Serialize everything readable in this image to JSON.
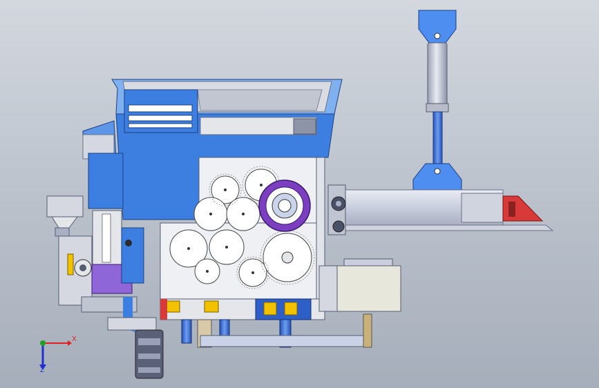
{
  "viewport": {
    "background_top": "#d3d8df",
    "background_bottom": "#a6aebb"
  },
  "colors": {
    "body_blue": "#3c7fe0",
    "body_blue_light": "#7fb0f0",
    "panel_grey": "#e4e6ea",
    "gear_purple": "#7b3fc0",
    "hopper_blue": "#4d8ef0",
    "cylinder_grey": "#c5c9d6",
    "accent_red": "#d83a3a",
    "accent_yellow": "#f2c200",
    "axis_x": "#e02020",
    "axis_y": "#20a020",
    "axis_z": "#2030d0"
  },
  "triad": {
    "x_label": "X",
    "z_label": "Z",
    "icon": "coordinate-triad-icon"
  }
}
